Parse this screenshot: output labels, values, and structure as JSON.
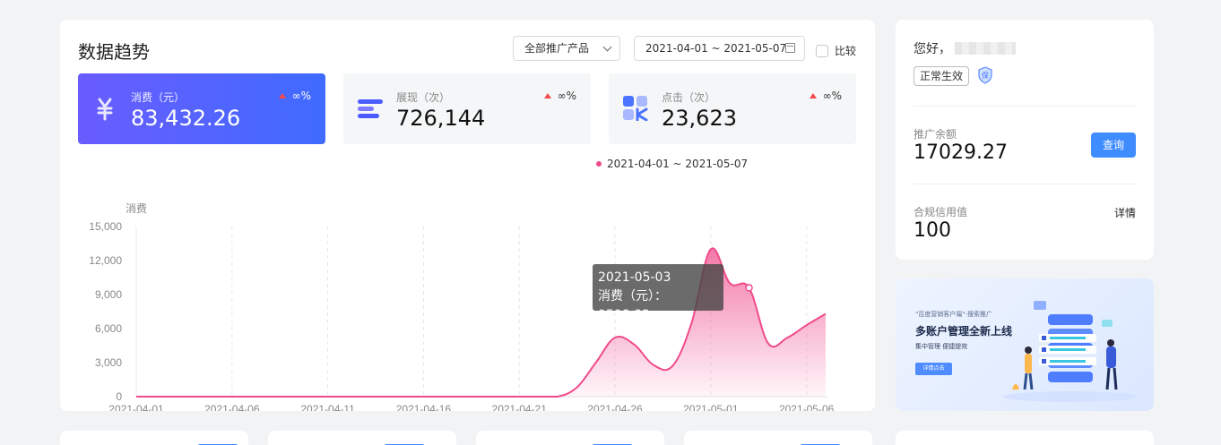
{
  "header": {
    "title": "数据趋势",
    "product_filter": "全部推广产品",
    "date_range": "2021-04-01 ~ 2021-05-07",
    "compare_label": "比较"
  },
  "metrics": [
    {
      "label": "消费（元）",
      "value": "83,432.26",
      "trend": "∞%",
      "icon": "yuan-icon"
    },
    {
      "label": "展现（次）",
      "value": "726,144",
      "trend": "∞%",
      "icon": "lines-icon"
    },
    {
      "label": "点击（次）",
      "value": "23,623",
      "trend": "∞%",
      "icon": "click-icon"
    }
  ],
  "colors": {
    "accent": "#3f8cff",
    "series": "#f04b8b",
    "trend_up": "#f5484a",
    "metric_gradient_start": "#6a5cff",
    "metric_gradient_end": "#3f6bff"
  },
  "chart_data": {
    "type": "area",
    "legend": "2021-04-01 ~ 2021-05-07",
    "ylabel": "消费",
    "ylim": [
      0,
      15000
    ],
    "yticks": [
      "15,000",
      "12,000",
      "9,000",
      "6,000",
      "3,000",
      "0"
    ],
    "ytick_values": [
      15000,
      12000,
      9000,
      6000,
      3000,
      0
    ],
    "xticks": [
      "2021-04-01",
      "2021-04-06",
      "2021-04-11",
      "2021-04-16",
      "2021-04-21",
      "2021-04-26",
      "2021-05-01",
      "2021-05-06"
    ],
    "x": [
      "2021-04-01",
      "2021-04-02",
      "2021-04-03",
      "2021-04-04",
      "2021-04-05",
      "2021-04-06",
      "2021-04-07",
      "2021-04-08",
      "2021-04-09",
      "2021-04-10",
      "2021-04-11",
      "2021-04-12",
      "2021-04-13",
      "2021-04-14",
      "2021-04-15",
      "2021-04-16",
      "2021-04-17",
      "2021-04-18",
      "2021-04-19",
      "2021-04-20",
      "2021-04-21",
      "2021-04-22",
      "2021-04-23",
      "2021-04-24",
      "2021-04-25",
      "2021-04-26",
      "2021-04-27",
      "2021-04-28",
      "2021-04-29",
      "2021-04-30",
      "2021-05-01",
      "2021-05-02",
      "2021-05-03",
      "2021-05-04",
      "2021-05-05",
      "2021-05-06",
      "2021-05-07"
    ],
    "series": [
      {
        "values": [
          0,
          0,
          0,
          0,
          0,
          0,
          0,
          0,
          0,
          0,
          0,
          0,
          0,
          0,
          0,
          0,
          0,
          0,
          0,
          0,
          0,
          0,
          0,
          800,
          3000,
          5200,
          4600,
          2800,
          2700,
          6500,
          13000,
          10000,
          9598.83,
          4700,
          5200,
          6300,
          7300
        ]
      }
    ],
    "grid": "vertical-dashed",
    "tooltip": {
      "date": "2021-05-03",
      "label": "消费（元）：9598.83"
    }
  },
  "user": {
    "greeting": "您好，",
    "status": "正常生效",
    "balance_label": "推广余额",
    "balance": "17029.27",
    "query_label": "查询",
    "credit_label": "合规信用值",
    "credit": "100",
    "detail_label": "详情"
  },
  "banner": {
    "subtitle": "\"百度营销客户端\"-搜索推广",
    "title": "多账户管理全新上线",
    "desc": "集中管理  便捷提效",
    "button": "详情点击"
  }
}
